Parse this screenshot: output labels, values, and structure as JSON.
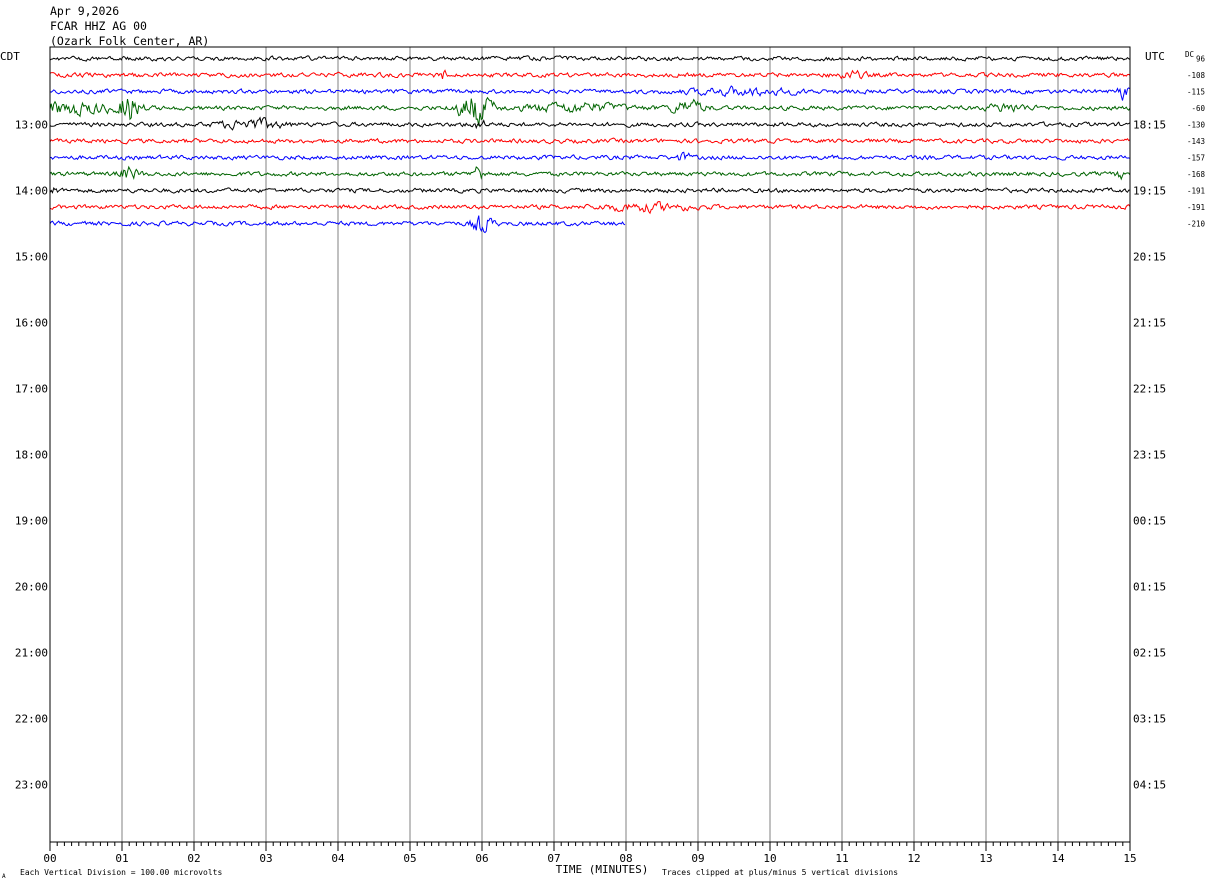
{
  "header": {
    "date": "Apr 9,2026",
    "channel": "FCAR HHZ AG 00",
    "location": "(Ozark Folk Center, AR)"
  },
  "left_zone": "CDT",
  "right_zone": "UTC",
  "dc_label": "DC",
  "footer": {
    "vertical_division": "Each Vertical Division =  100.00 microvolts",
    "clip_note": "Traces clipped at plus/minus 5 vertical divisions",
    "corner_mark": "A"
  },
  "colors": {
    "trace_cycle": [
      "#000000",
      "#ff0000",
      "#0000ff",
      "#006400"
    ],
    "grid": "#808080"
  },
  "chart_data": {
    "type": "line",
    "title": "",
    "xlabel": "TIME (MINUTES)",
    "ylabel": "",
    "xlim": [
      0,
      15
    ],
    "x_ticks": [
      "00",
      "01",
      "02",
      "03",
      "04",
      "05",
      "06",
      "07",
      "08",
      "09",
      "10",
      "11",
      "12",
      "13",
      "14",
      "15"
    ],
    "left_hour_labels": [
      "13:00",
      "14:00",
      "15:00",
      "16:00",
      "17:00",
      "18:00",
      "19:00",
      "20:00",
      "21:00",
      "22:00",
      "23:00"
    ],
    "right_hour_labels": [
      "18:15",
      "19:15",
      "20:15",
      "21:15",
      "22:15",
      "23:15",
      "00:15",
      "01:15",
      "02:15",
      "03:15",
      "04:15"
    ],
    "rows_per_hour": 4,
    "row_minutes": 15,
    "grid": true,
    "dc_offsets": [
      "96",
      "-108",
      "-115",
      "-60",
      "-130",
      "-143",
      "-157",
      "-168",
      "-191",
      "-191",
      "-210"
    ],
    "series": [
      {
        "row": 0,
        "color": "#000000",
        "end_minute": 15,
        "events": []
      },
      {
        "row": 1,
        "color": "#ff0000",
        "end_minute": 15,
        "events": [
          [
            5.45,
            0.2,
            2.0
          ],
          [
            11.1,
            0.5,
            1.4
          ]
        ]
      },
      {
        "row": 2,
        "color": "#0000ff",
        "end_minute": 15,
        "events": [
          [
            9.6,
            1.5,
            1.4
          ],
          [
            14.9,
            0.15,
            3.5
          ]
        ]
      },
      {
        "row": 3,
        "color": "#006400",
        "end_minute": 15,
        "events": [
          [
            0.1,
            1.8,
            2.6
          ],
          [
            1.1,
            0.3,
            7
          ],
          [
            5.9,
            0.5,
            7
          ],
          [
            7.3,
            1.5,
            1.8
          ],
          [
            8.85,
            0.5,
            3
          ],
          [
            13.3,
            0.6,
            1.6
          ]
        ]
      },
      {
        "row": 4,
        "color": "#000000",
        "end_minute": 15,
        "events": [
          [
            2.8,
            0.9,
            2.0
          ],
          [
            5.95,
            0.3,
            1.4
          ]
        ]
      },
      {
        "row": 5,
        "color": "#ff0000",
        "end_minute": 15,
        "events": []
      },
      {
        "row": 6,
        "color": "#0000ff",
        "end_minute": 15,
        "events": [
          [
            8.8,
            0.2,
            1.6
          ]
        ]
      },
      {
        "row": 7,
        "color": "#006400",
        "end_minute": 15,
        "events": [
          [
            1.1,
            0.3,
            2.5
          ],
          [
            5.95,
            0.2,
            3.5
          ],
          [
            14.9,
            0.2,
            1.6
          ]
        ]
      },
      {
        "row": 8,
        "color": "#000000",
        "end_minute": 15,
        "events": [
          [
            0.05,
            0.15,
            1.5
          ]
        ]
      },
      {
        "row": 9,
        "color": "#ff0000",
        "end_minute": 15,
        "events": [
          [
            8.3,
            1.3,
            1.5
          ]
        ]
      },
      {
        "row": 10,
        "color": "#0000ff",
        "end_minute": 8.0,
        "events": [
          [
            6.0,
            0.3,
            4.0
          ]
        ]
      }
    ]
  }
}
